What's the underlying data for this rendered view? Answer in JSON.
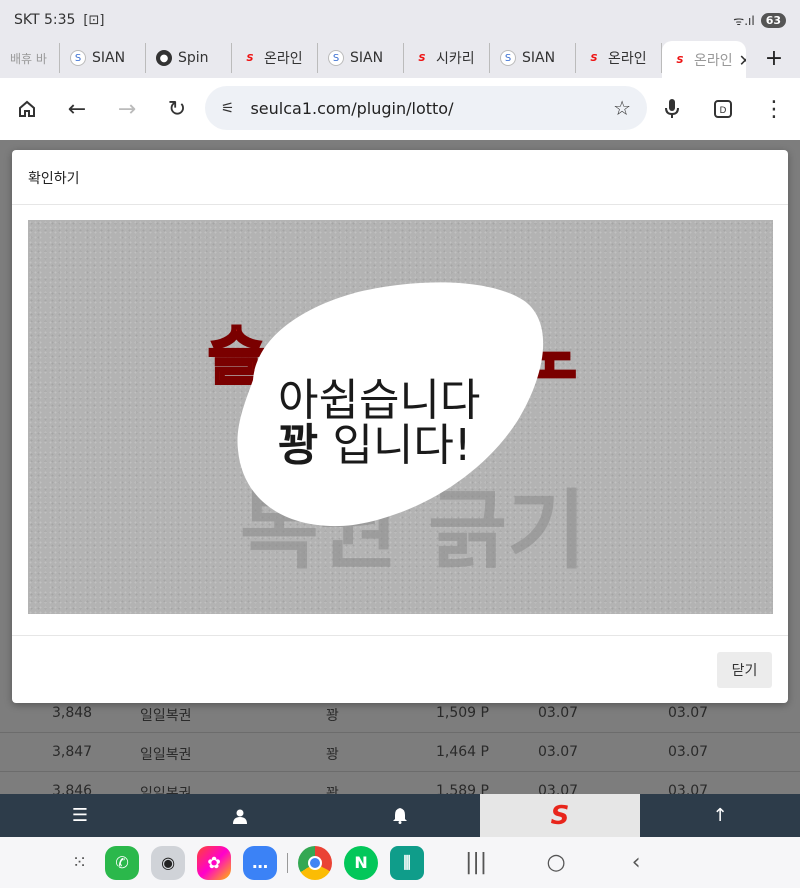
{
  "status_bar": {
    "carrier_time": "SKT 5:35",
    "battery": "63",
    "signal_text": "ᯤ.ıl"
  },
  "tabs": [
    {
      "label": "배휴 바",
      "favicon": "blank"
    },
    {
      "label": "SIAN",
      "favicon": "sian-icon"
    },
    {
      "label": "Spin",
      "favicon": "globe-icon"
    },
    {
      "label": "온라인",
      "favicon": "s-logo-icon"
    },
    {
      "label": "SIAN",
      "favicon": "sian-icon"
    },
    {
      "label": "시카리",
      "favicon": "s-logo-icon"
    },
    {
      "label": "SIAN",
      "favicon": "sian-icon"
    },
    {
      "label": "온라인",
      "favicon": "s-logo-icon"
    },
    {
      "label": "온라인",
      "favicon": "s-logo-icon",
      "active": true
    }
  ],
  "toolbar": {
    "url": "seulca1.com/plugin/lotto/"
  },
  "background_rows": [
    {
      "no": "3,848",
      "name": "일일복권",
      "result": "꽝",
      "points": "1,509 P",
      "d1": "03.07",
      "d2": "03.07"
    },
    {
      "no": "3,847",
      "name": "일일복권",
      "result": "꽝",
      "points": "1,464 P",
      "d1": "03.07",
      "d2": "03.07"
    },
    {
      "no": "3,846",
      "name": "일일복권",
      "result": "꽝",
      "points": "1,589 P",
      "d1": "03.07",
      "d2": "03.07"
    }
  ],
  "modal": {
    "title": "확인하기",
    "scratch": {
      "brand_left": "슬",
      "brand_right": "노",
      "hidden_text": "복권 긁기",
      "message_line1": "아쉽습니다",
      "message_line2_bold": "꽝",
      "message_line2_rest": " 입니다!"
    },
    "close_label": "닫기"
  },
  "colors": {
    "brand_red": "#e8251b",
    "nav_bg": "#2d3c4a",
    "dim_bg": "#7d7d7d"
  }
}
